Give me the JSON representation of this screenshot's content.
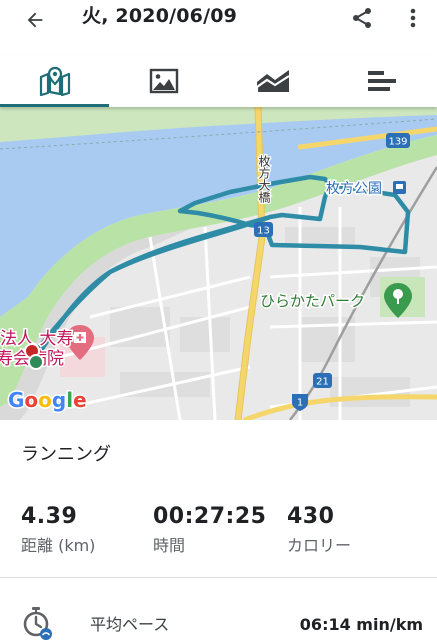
{
  "header": {
    "title": "火, 2020/06/09",
    "back_icon": "arrow-back-icon",
    "share_icon": "share-icon",
    "more_icon": "more-vert-icon"
  },
  "tabs": [
    {
      "icon": "map-icon",
      "active": true
    },
    {
      "icon": "image-icon",
      "active": false
    },
    {
      "icon": "area-chart-icon",
      "active": false
    },
    {
      "icon": "list-bars-icon",
      "active": false
    }
  ],
  "map": {
    "labels": {
      "bridge": "枚方大橋",
      "station": "枚方公園",
      "park": "ひらかたパーク",
      "hospital_line1": "法人 大寿",
      "hospital_line2": "寿会病院"
    },
    "shields": {
      "route_13": "13",
      "route_139": "139",
      "route_21": "21",
      "route_1": "1"
    },
    "attribution": "Google",
    "attribution_letters": [
      "G",
      "o",
      "o",
      "g",
      "l",
      "e"
    ]
  },
  "activity": {
    "type": "ランニング"
  },
  "stats": [
    {
      "value": "4.39",
      "label": "距離 (km)"
    },
    {
      "value": "00:27:25",
      "label": "時間"
    },
    {
      "value": "430",
      "label": "カロリー"
    }
  ],
  "pace": {
    "icon": "pace-stopwatch-icon",
    "label": "平均ペース",
    "value": "06:14 min/km"
  },
  "colors": {
    "accent": "#1e6d78",
    "route": "#2f8ca6",
    "water": "#a9cbf2",
    "park": "#b9e3a6",
    "land": "#e9e9e9",
    "road_highway": "#f5d66a",
    "route_start": "#2e8b57",
    "route_end": "#c62828",
    "text_secondary": "#5f6368"
  }
}
